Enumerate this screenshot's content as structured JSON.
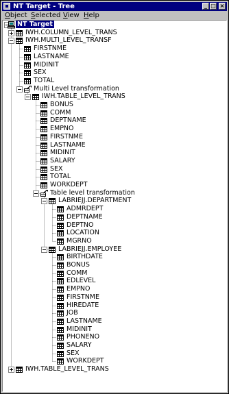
{
  "window": {
    "title": "NT Target - Tree",
    "controls": [
      "_",
      "□",
      "×"
    ]
  },
  "menu": [
    {
      "pre": "",
      "ul": "O",
      "post": "bject"
    },
    {
      "pre": "",
      "ul": "S",
      "post": "elected"
    },
    {
      "pre": "",
      "ul": "V",
      "post": "iew"
    },
    {
      "pre": "",
      "ul": "H",
      "post": "elp"
    }
  ],
  "tree": [
    {
      "label": "NT Target",
      "depth": 0,
      "icon": "computer-icon",
      "bold": true,
      "selected": true,
      "toggle": "minus"
    },
    {
      "label": "IWH.COLUMN_LEVEL_TRANS",
      "depth": 1,
      "icon": "table-icon",
      "toggle": "plus"
    },
    {
      "label": "IWH.MULTI_LEVEL_TRANSF",
      "depth": 1,
      "icon": "table-icon",
      "toggle": "minus"
    },
    {
      "label": "FIRSTNME",
      "depth": 2,
      "icon": "table-icon"
    },
    {
      "label": "LASTNAME",
      "depth": 2,
      "icon": "table-icon"
    },
    {
      "label": "MIDINIT",
      "depth": 2,
      "icon": "table-icon"
    },
    {
      "label": "SEX",
      "depth": 2,
      "icon": "table-icon"
    },
    {
      "label": "TOTAL",
      "depth": 2,
      "icon": "table-icon"
    },
    {
      "label": "Multi Level transformation",
      "depth": 2,
      "icon": "transform-icon",
      "toggle": "minus"
    },
    {
      "label": "IWH.TABLE_LEVEL_TRANS",
      "depth": 3,
      "icon": "table-icon",
      "toggle": "minus"
    },
    {
      "label": "BONUS",
      "depth": 4,
      "icon": "table-icon"
    },
    {
      "label": "COMM",
      "depth": 4,
      "icon": "table-icon"
    },
    {
      "label": "DEPTNAME",
      "depth": 4,
      "icon": "table-icon"
    },
    {
      "label": "EMPNO",
      "depth": 4,
      "icon": "table-icon"
    },
    {
      "label": "FIRSTNME",
      "depth": 4,
      "icon": "table-icon"
    },
    {
      "label": "LASTNAME",
      "depth": 4,
      "icon": "table-icon"
    },
    {
      "label": "MIDINIT",
      "depth": 4,
      "icon": "table-icon"
    },
    {
      "label": "SALARY",
      "depth": 4,
      "icon": "table-icon"
    },
    {
      "label": "SEX",
      "depth": 4,
      "icon": "table-icon"
    },
    {
      "label": "TOTAL",
      "depth": 4,
      "icon": "table-icon"
    },
    {
      "label": "WORKDEPT",
      "depth": 4,
      "icon": "table-icon"
    },
    {
      "label": "Table level transformation",
      "depth": 4,
      "icon": "transform-icon",
      "toggle": "minus"
    },
    {
      "label": "LABRIEJJ.DEPARTMENT",
      "depth": 5,
      "icon": "table-icon",
      "toggle": "minus"
    },
    {
      "label": "ADMRDEPT",
      "depth": 6,
      "icon": "table-icon"
    },
    {
      "label": "DEPTNAME",
      "depth": 6,
      "icon": "table-icon"
    },
    {
      "label": "DEPTNO",
      "depth": 6,
      "icon": "table-icon"
    },
    {
      "label": "LOCATION",
      "depth": 6,
      "icon": "table-icon"
    },
    {
      "label": "MGRNO",
      "depth": 6,
      "icon": "table-icon"
    },
    {
      "label": "LABRIEJJ.EMPLOYEE",
      "depth": 5,
      "icon": "table-icon",
      "toggle": "minus"
    },
    {
      "label": "BIRTHDATE",
      "depth": 6,
      "icon": "table-icon"
    },
    {
      "label": "BONUS",
      "depth": 6,
      "icon": "table-icon"
    },
    {
      "label": "COMM",
      "depth": 6,
      "icon": "table-icon"
    },
    {
      "label": "EDLEVEL",
      "depth": 6,
      "icon": "table-icon"
    },
    {
      "label": "EMPNO",
      "depth": 6,
      "icon": "table-icon"
    },
    {
      "label": "FIRSTNME",
      "depth": 6,
      "icon": "table-icon"
    },
    {
      "label": "HIREDATE",
      "depth": 6,
      "icon": "table-icon"
    },
    {
      "label": "JOB",
      "depth": 6,
      "icon": "table-icon"
    },
    {
      "label": "LASTNAME",
      "depth": 6,
      "icon": "table-icon"
    },
    {
      "label": "MIDINIT",
      "depth": 6,
      "icon": "table-icon"
    },
    {
      "label": "PHONENO",
      "depth": 6,
      "icon": "table-icon"
    },
    {
      "label": "SALARY",
      "depth": 6,
      "icon": "table-icon"
    },
    {
      "label": "SEX",
      "depth": 6,
      "icon": "table-icon"
    },
    {
      "label": "WORKDEPT",
      "depth": 6,
      "icon": "table-icon"
    },
    {
      "label": "IWH.TABLE_LEVEL_TRANS",
      "depth": 1,
      "icon": "table-icon",
      "toggle": "plus"
    }
  ],
  "colors": {
    "titlebar": "#000080",
    "face": "#c0c0c0",
    "selection": "#000080",
    "connector": "#808080"
  }
}
